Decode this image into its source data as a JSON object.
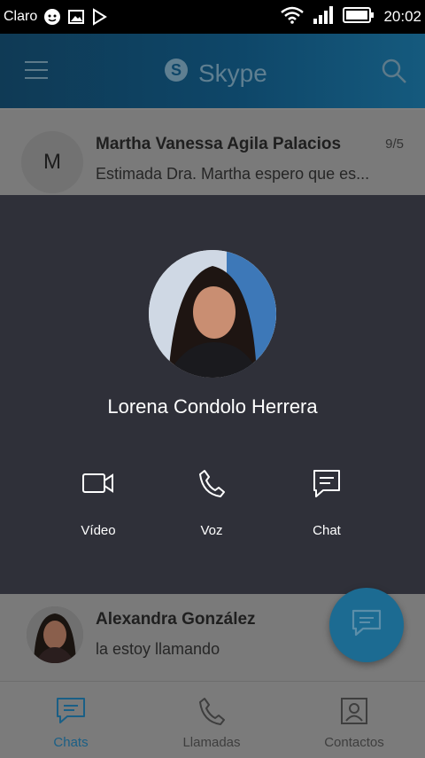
{
  "status_bar": {
    "carrier": "Claro",
    "time": "20:02"
  },
  "header": {
    "title": "Skype"
  },
  "chats": [
    {
      "initial": "M",
      "name": "Martha Vanessa Agila Palacios",
      "preview": "Estimada Dra. Martha espero que es...",
      "date": "9/5"
    },
    {
      "name": "Alexandra González",
      "preview": "la estoy llamando"
    }
  ],
  "contact_card": {
    "name": "Lorena Condolo Herrera",
    "actions": [
      {
        "label": "Vídeo",
        "icon": "video-icon"
      },
      {
        "label": "Voz",
        "icon": "phone-icon"
      },
      {
        "label": "Chat",
        "icon": "chat-icon"
      }
    ]
  },
  "bottom_nav": [
    {
      "label": "Chats",
      "icon": "chat-icon",
      "active": true
    },
    {
      "label": "Llamadas",
      "icon": "phone-icon"
    },
    {
      "label": "Contactos",
      "icon": "contacts-icon"
    }
  ],
  "colors": {
    "card_bg": "#2f3039",
    "accent": "#1c6b92",
    "active_tab": "#1a5f86"
  }
}
